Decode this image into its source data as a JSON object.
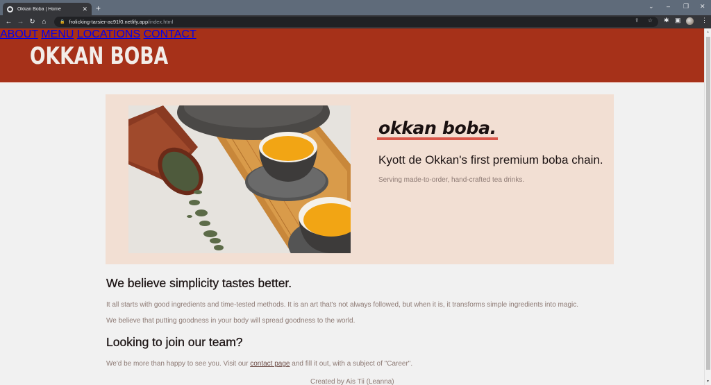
{
  "browser": {
    "tab_title": "Okkan Boba | Home",
    "tab_close": "✕",
    "new_tab": "+",
    "url_host": "frolicking-tarsier-ac91f0.netlify.app",
    "url_path": "/index.html",
    "icons": {
      "back": "←",
      "forward": "→",
      "reload": "↻",
      "home": "⌂",
      "lock": "🔒",
      "share": "⇪",
      "star": "☆",
      "extensions": "✱",
      "sidepanel": "▣",
      "menu": "⋮",
      "tab_search": "⌄",
      "minimize": "–",
      "restore": "❐",
      "close": "✕"
    }
  },
  "header": {
    "logo": "OKKAN BOBA",
    "nav": [
      {
        "label": "ABOUT"
      },
      {
        "label": "MENU"
      },
      {
        "label": "LOCATIONS"
      },
      {
        "label": "CONTACT"
      }
    ],
    "color": "#a63119"
  },
  "hero": {
    "brand": "okkan boba.",
    "tagline": "Kyott de Okkan's first premium boba chain.",
    "subtagline": "Serving made-to-order, hand-crafted tea drinks.",
    "image_alt": "tea cups on wooden tray with loose tea leaves",
    "background": "#f2dfd3",
    "underline_color": "#d9574a"
  },
  "content": {
    "heading1": "We believe simplicity tastes better.",
    "para1": "It all starts with good ingredients and time-tested methods. It is an art that's not always followed, but when it is, it transforms simple ingredients into magic.",
    "para2": "We believe that putting goodness in your body will spread goodness to the world.",
    "heading2": "Looking to join our team?",
    "para3_before": "We'd be more than happy to see you. Visit our ",
    "para3_link": "contact page",
    "para3_after": " and fill it out, with a subject of \"Career\"."
  },
  "footer": {
    "credit": "Created by Ais Tii (Leanna)"
  }
}
